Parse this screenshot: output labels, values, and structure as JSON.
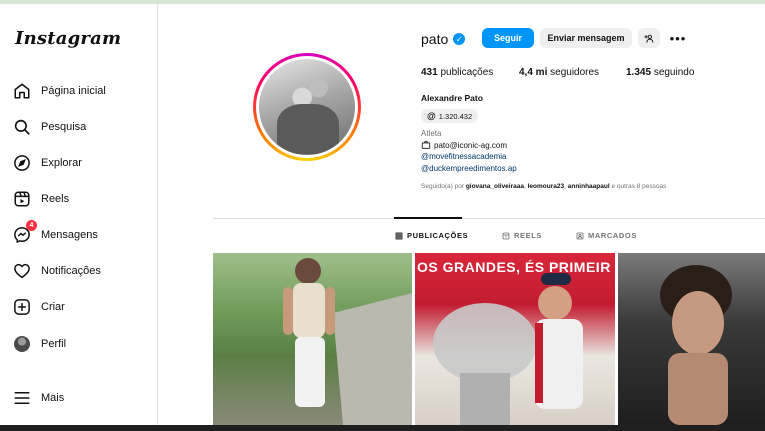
{
  "app": {
    "logo": "Instagram"
  },
  "sidebar": {
    "items": [
      {
        "label": "Página inicial",
        "icon": "home-icon"
      },
      {
        "label": "Pesquisa",
        "icon": "search-icon"
      },
      {
        "label": "Explorar",
        "icon": "compass-icon"
      },
      {
        "label": "Reels",
        "icon": "reels-icon"
      },
      {
        "label": "Mensagens",
        "icon": "messenger-icon",
        "badge": "4"
      },
      {
        "label": "Notificações",
        "icon": "heart-icon"
      },
      {
        "label": "Criar",
        "icon": "plus-square-icon"
      },
      {
        "label": "Perfil",
        "icon": "avatar"
      }
    ],
    "more": {
      "label": "Mais",
      "icon": "menu-icon"
    }
  },
  "profile": {
    "username": "pato",
    "verified": true,
    "follow_label": "Seguir",
    "message_label": "Enviar mensagem",
    "stats": {
      "posts_value": "431",
      "posts_label": "publicações",
      "followers_value": "4,4 mi",
      "followers_label": "seguidores",
      "following_value": "1.345",
      "following_label": "seguindo"
    },
    "full_name": "Alexandre Pato",
    "threads_count": "1.320.432",
    "category": "Atleta",
    "email": "pato@iconic-ag.com",
    "mentions": [
      "@movefitnessacademia",
      "@duckempreedimentos.ap"
    ],
    "followed_by": {
      "prefix": "Seguido(a) por",
      "users": [
        "giovana_oliveiraaa",
        "leomoura23",
        "anninhaapaul"
      ],
      "suffix": "e outras 8 pessoas"
    }
  },
  "tabs": [
    {
      "label": "PUBLICAÇÕES",
      "active": true,
      "icon": "grid-icon"
    },
    {
      "label": "REELS",
      "active": false,
      "icon": "reels-icon"
    },
    {
      "label": "MARCADOS",
      "active": false,
      "icon": "tagged-icon"
    }
  ],
  "posts": {
    "banner_text": "OS GRANDES, ÉS PRIMEIR"
  },
  "colors": {
    "accent": "#0095f6",
    "badge": "#ff3040",
    "link": "#00376b"
  }
}
